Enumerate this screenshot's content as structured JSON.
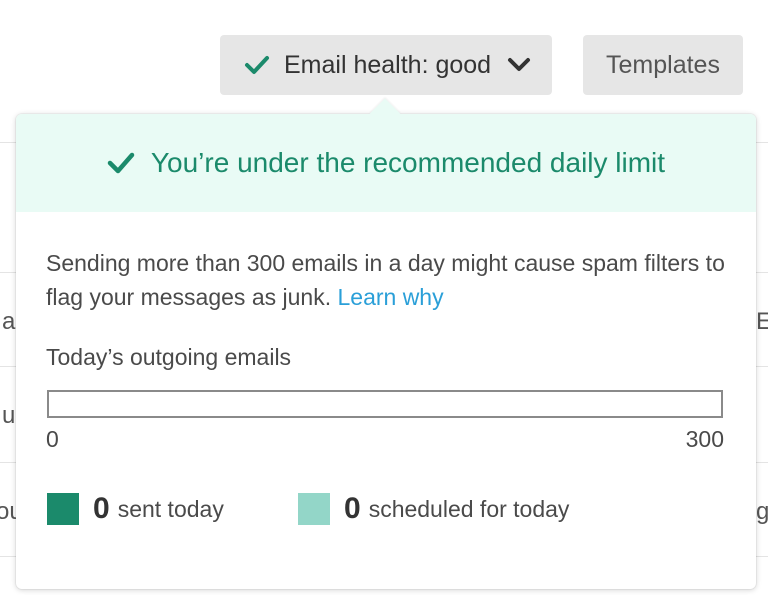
{
  "toolbar": {
    "health_label": "Email health: good",
    "templates_label": "Templates"
  },
  "popover": {
    "header_title": "You’re under the recommended daily limit",
    "description": "Sending more than 300 emails in a day might cause spam filters to flag your messages as junk.",
    "learn_link": "Learn why",
    "section_label": "Today’s outgoing emails",
    "bar": {
      "min_label": "0",
      "max_label": "300",
      "sent_fraction": 0
    },
    "legend": {
      "sent_count": "0",
      "sent_label": "sent today",
      "scheduled_count": "0",
      "scheduled_label": "scheduled for today"
    }
  },
  "background_fragments": {
    "left_1": "a",
    "left_2": "u",
    "left_3": "ou",
    "right_1": "E",
    "right_2": "g"
  },
  "colors": {
    "accent": "#1b8a6b",
    "header_bg": "#e9fbf5",
    "link": "#2a9fd8",
    "sent_swatch": "#1b8a6b",
    "scheduled_swatch": "#93d6c8",
    "button_bg": "#e6e6e6"
  },
  "icons": {
    "health_check": "check-icon",
    "health_dropdown": "chevron-down-icon",
    "header_check": "check-icon"
  }
}
